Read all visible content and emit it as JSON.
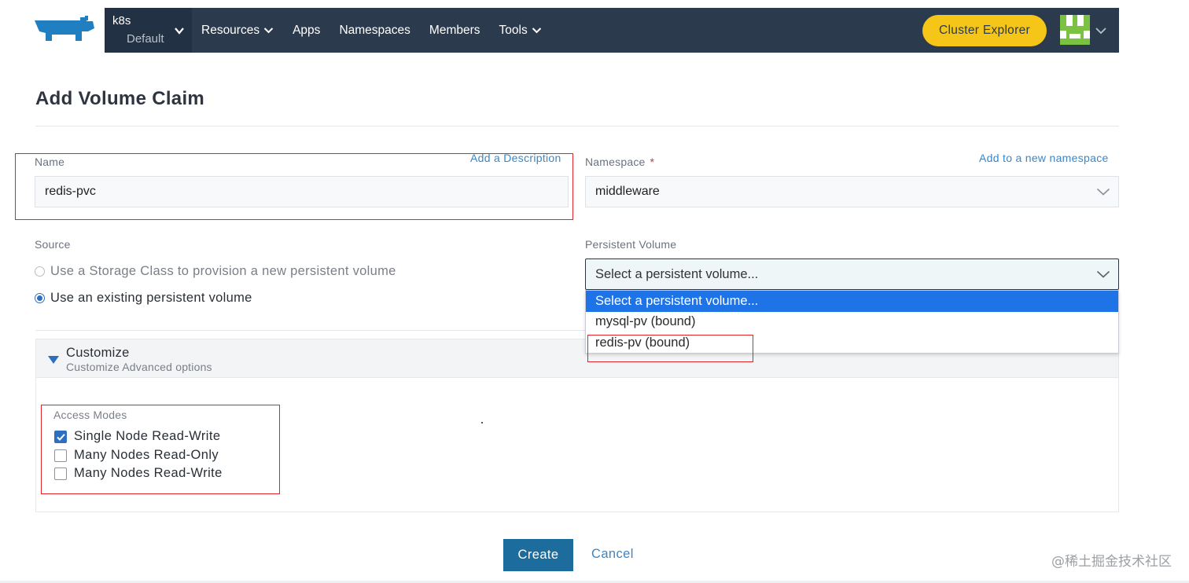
{
  "navbar": {
    "logo_icon": "rancher-logo-icon",
    "cluster": {
      "name": "k8s",
      "project": "Default"
    },
    "items": [
      {
        "label": "Resources",
        "has_dropdown": true
      },
      {
        "label": "Apps",
        "has_dropdown": false
      },
      {
        "label": "Namespaces",
        "has_dropdown": false
      },
      {
        "label": "Members",
        "has_dropdown": false
      },
      {
        "label": "Tools",
        "has_dropdown": true
      }
    ],
    "cluster_explorer_label": "Cluster Explorer",
    "avatar_color": "#7cc242"
  },
  "page": {
    "title": "Add Volume Claim"
  },
  "form": {
    "name": {
      "label": "Name",
      "value": "redis-pvc",
      "add_description_link": "Add a Description"
    },
    "namespace": {
      "label": "Namespace",
      "required_mark": "*",
      "value": "middleware",
      "add_namespace_link": "Add to a new namespace"
    },
    "source": {
      "label": "Source",
      "options": [
        {
          "label": "Use a Storage Class to provision a new persistent volume",
          "checked": false
        },
        {
          "label": "Use an existing persistent volume",
          "checked": true
        }
      ]
    },
    "persistent_volume": {
      "label": "Persistent Volume",
      "selected": "Select a persistent volume...",
      "options": [
        {
          "label": "Select a persistent volume...",
          "highlighted": true
        },
        {
          "label": "mysql-pv (bound)",
          "highlighted": false
        },
        {
          "label": "redis-pv (bound)",
          "highlighted": false
        }
      ]
    }
  },
  "customize": {
    "title": "Customize",
    "subtitle": "Customize Advanced options",
    "access_modes": {
      "label": "Access Modes",
      "options": [
        {
          "label": "Single Node Read-Write",
          "checked": true
        },
        {
          "label": "Many Nodes Read-Only",
          "checked": false
        },
        {
          "label": "Many Nodes Read-Write",
          "checked": false
        }
      ]
    }
  },
  "actions": {
    "create_label": "Create",
    "cancel_label": "Cancel"
  },
  "watermark": "@稀土掘金技术社区",
  "colors": {
    "navbar_bg": "#2b3a4d",
    "accent_yellow": "#f5c518",
    "primary_button": "#1c6d9e",
    "link": "#3a86c8",
    "dropdown_highlight": "#1e74e6",
    "annotation_red": "#e0242a"
  }
}
